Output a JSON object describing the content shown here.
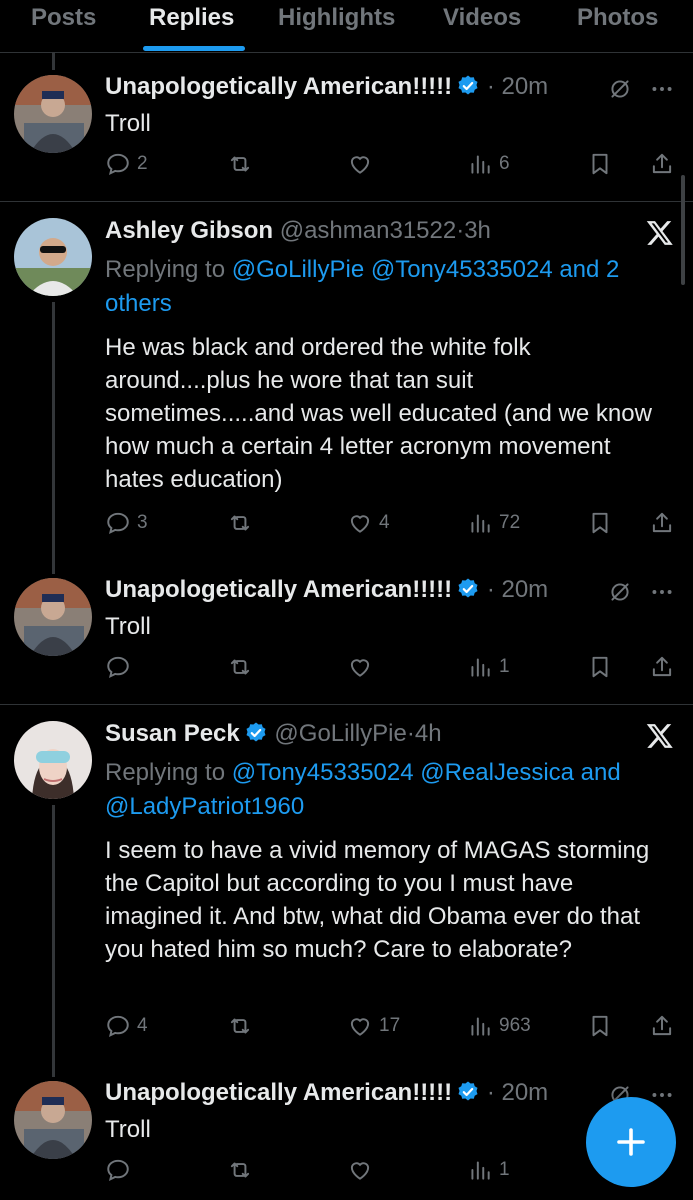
{
  "tabs": [
    "Posts",
    "Replies",
    "Highlights",
    "Videos",
    "Photos"
  ],
  "icons": {
    "reply": "reply-icon",
    "retweet": "retweet-icon",
    "like": "like-icon",
    "views": "views-icon",
    "bookmark": "bookmark-icon",
    "share": "share-icon",
    "verified": "verified-badge-icon",
    "muted": "muted-icon",
    "more": "more-icon",
    "x": "x-logo-icon",
    "compose": "compose-plus-icon"
  },
  "colors": {
    "accent": "#1d9bf0",
    "background": "#000000",
    "muted_text": "#71767b",
    "text": "#e7e9ea"
  },
  "tweets": [
    {
      "name": "Unapologetically American!!!!!",
      "handle": "",
      "time": "20m",
      "text": "Troll",
      "reply_count": "2",
      "retweet_count": "",
      "like_count": "",
      "views": "6"
    },
    {
      "name": "Ashley Gibson",
      "handle": "@ashman31522",
      "time": "3h",
      "replying_prefix": "Replying to",
      "replying_to": "@GoLillyPie @Tony45335024 and 2 others",
      "text": "He was black and ordered the white folk around....plus he wore that tan suit sometimes.....and was well educated (and we know how much a certain 4 letter acronym movement hates education)",
      "reply_count": "3",
      "retweet_count": "",
      "like_count": "4",
      "views": "72"
    },
    {
      "name": "Unapologetically American!!!!!",
      "handle": "",
      "time": "20m",
      "text": "Troll",
      "reply_count": "",
      "retweet_count": "",
      "like_count": "",
      "views": "1"
    },
    {
      "name": "Susan Peck",
      "handle": "@GoLillyPie",
      "time": "4h",
      "replying_prefix": "Replying to",
      "replying_to": "@Tony45335024 @RealJessica and @LadyPatriot1960",
      "text": "I seem to have a vivid memory of MAGAS storming the Capitol but according to you I must have imagined it. And btw, what did Obama ever do that you hated him so much? Care to elaborate?",
      "reply_count": "4",
      "retweet_count": "",
      "like_count": "17",
      "views": "963"
    },
    {
      "name": "Unapologetically American!!!!!",
      "handle": "",
      "time": "20m",
      "text": "Troll",
      "reply_count": "",
      "retweet_count": "",
      "like_count": "",
      "views": "1"
    }
  ]
}
